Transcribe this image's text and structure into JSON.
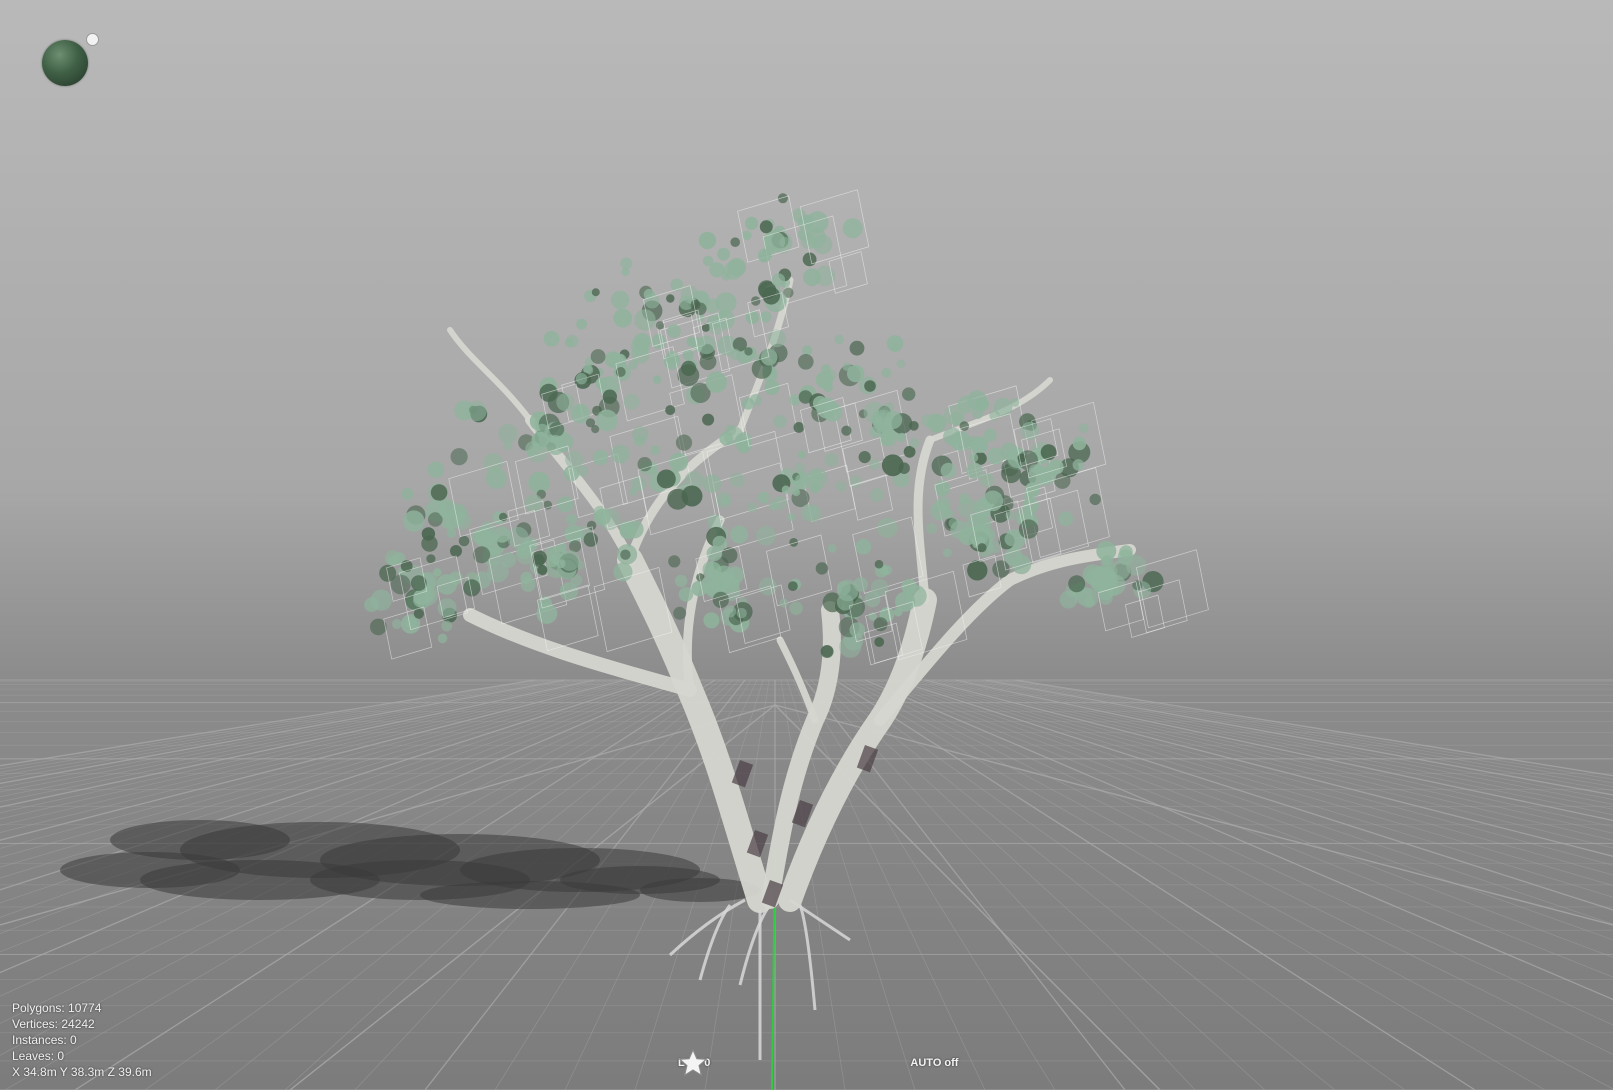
{
  "viewport": {
    "stats": {
      "polygons": "Polygons: 10774",
      "vertices": "Vertices: 24242",
      "instances": "Instances: 0",
      "leaves": "Leaves: 0",
      "dimensions": "X 34.8m Y 38.3m Z 39.6m"
    },
    "lod": {
      "label": "LOD 0",
      "stars": [
        "star-icon",
        "star-icon",
        "star-icon",
        "star-icon",
        "star-icon"
      ],
      "auto": "AUTO off"
    },
    "colors": {
      "leaves": "#8fb39c",
      "leaves_dark": "#4a6650",
      "bark": "#d6d6d0",
      "ground_grid": "#a9a9a9",
      "axis_green": "#2ecc40"
    },
    "light_gizmo": "sun-sphere-icon"
  }
}
